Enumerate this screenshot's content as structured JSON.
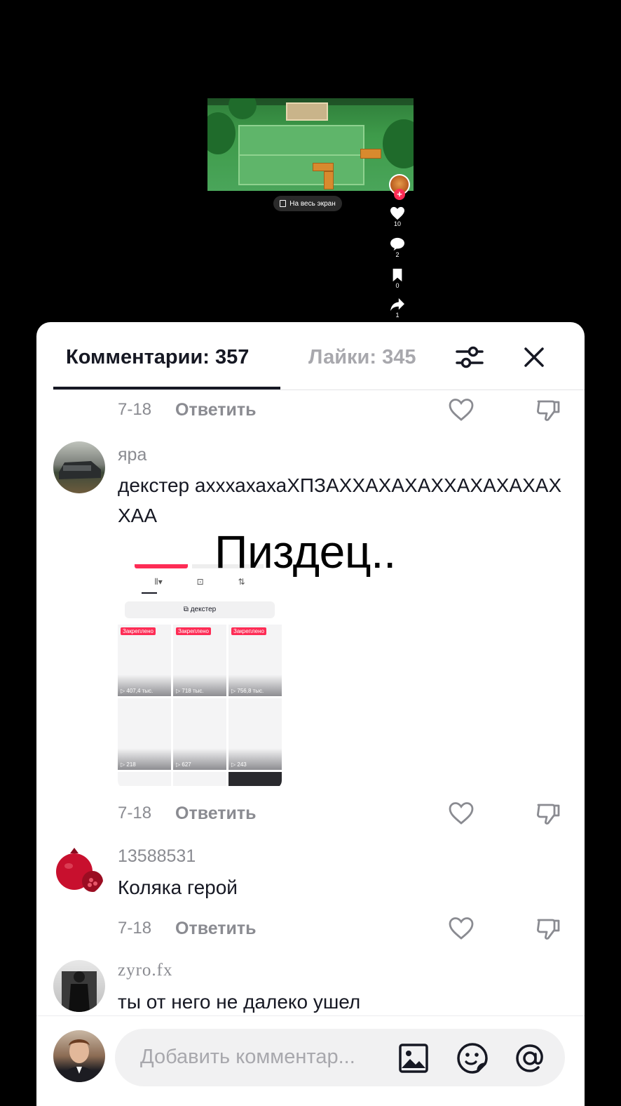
{
  "video": {
    "fullscreen_label": "На весь экран",
    "actions": [
      {
        "name": "like",
        "count": "10"
      },
      {
        "name": "comment",
        "count": "2"
      },
      {
        "name": "bookmark",
        "count": "0"
      },
      {
        "name": "share",
        "count": "1"
      }
    ]
  },
  "sheet": {
    "tab_comments": "Комментарии: 357",
    "tab_likes": "Лайки: 345",
    "overlay_caption": "Пиздец.."
  },
  "comments": [
    {
      "date": "7-18",
      "reply": "Ответить"
    },
    {
      "username": "яра",
      "text": "декстер ахххахахаХПЗАХХАХАХАХХАХАХАХАХХАА",
      "date": "7-18",
      "reply": "Ответить",
      "image": {
        "search_label": "декстер",
        "pinned_label": "Закреплено",
        "views": [
          "407,4 тыс.",
          "718 тыс.",
          "756,8 тыс.",
          "218",
          "627",
          "243"
        ]
      }
    },
    {
      "username": "13588531",
      "text": "Коляка герой",
      "date": "7-18",
      "reply": "Ответить"
    },
    {
      "username": "zyro.fx",
      "text": "ты от него не далеко ушел"
    }
  ],
  "input": {
    "placeholder": "Добавить комментар..."
  },
  "colors": {
    "accent": "#fe2c55",
    "text_primary": "#161823",
    "text_secondary": "#8a8b91"
  }
}
